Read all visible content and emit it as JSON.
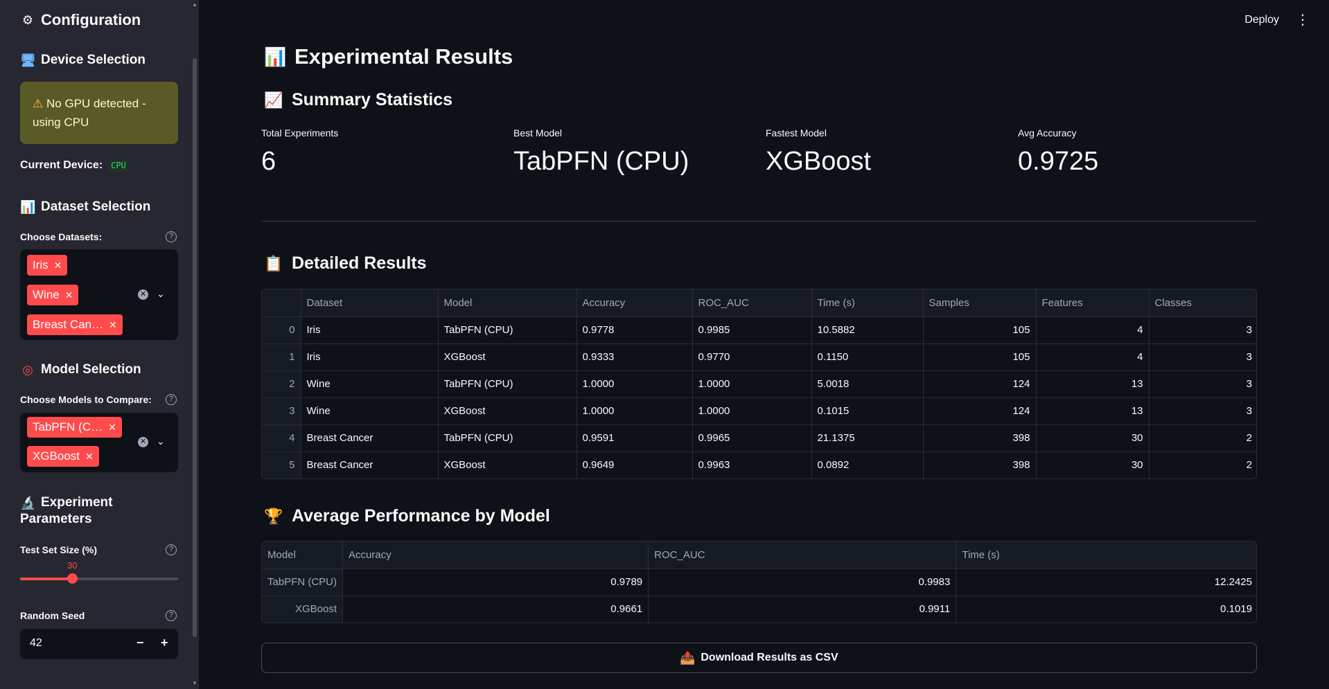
{
  "sidebar": {
    "title": "Configuration",
    "device_section": "Device Selection",
    "warning_line1": "No GPU detected -",
    "warning_line2": "using CPU",
    "current_device_label": "Current Device:",
    "current_device_value": "CPU",
    "dataset_section": "Dataset Selection",
    "datasets_label": "Choose Datasets:",
    "dataset_tags": [
      "Iris",
      "Wine",
      "Breast Can…"
    ],
    "model_section": "Model Selection",
    "models_label": "Choose Models to Compare:",
    "model_tags": [
      "TabPFN (C…",
      "XGBoost"
    ],
    "experiment_section_line1": "Experiment",
    "experiment_section_line2": "Parameters",
    "test_size_label": "Test Set Size (%)",
    "test_size_value": "30",
    "test_size_fraction": 0.33,
    "seed_label": "Random Seed",
    "seed_value": "42"
  },
  "topbar": {
    "deploy_label": "Deploy"
  },
  "main": {
    "title": "Experimental Results",
    "summary_title": "Summary Statistics",
    "metrics": [
      {
        "label": "Total Experiments",
        "value": "6"
      },
      {
        "label": "Best Model",
        "value": "TabPFN (CPU)"
      },
      {
        "label": "Fastest Model",
        "value": "XGBoost"
      },
      {
        "label": "Avg Accuracy",
        "value": "0.9725"
      }
    ],
    "detailed_title": "Detailed Results",
    "detailed_columns": [
      "",
      "Dataset",
      "Model",
      "Accuracy",
      "ROC_AUC",
      "Time (s)",
      "Samples",
      "Features",
      "Classes"
    ],
    "detailed_rows": [
      [
        "0",
        "Iris",
        "TabPFN (CPU)",
        "0.9778",
        "0.9985",
        "10.5882",
        "105",
        "4",
        "3"
      ],
      [
        "1",
        "Iris",
        "XGBoost",
        "0.9333",
        "0.9770",
        "0.1150",
        "105",
        "4",
        "3"
      ],
      [
        "2",
        "Wine",
        "TabPFN (CPU)",
        "1.0000",
        "1.0000",
        "5.0018",
        "124",
        "13",
        "3"
      ],
      [
        "3",
        "Wine",
        "XGBoost",
        "1.0000",
        "1.0000",
        "0.1015",
        "124",
        "13",
        "3"
      ],
      [
        "4",
        "Breast Cancer",
        "TabPFN (CPU)",
        "0.9591",
        "0.9965",
        "21.1375",
        "398",
        "30",
        "2"
      ],
      [
        "5",
        "Breast Cancer",
        "XGBoost",
        "0.9649",
        "0.9963",
        "0.0892",
        "398",
        "30",
        "2"
      ]
    ],
    "avg_title": "Average Performance by Model",
    "avg_columns": [
      "Model",
      "Accuracy",
      "ROC_AUC",
      "Time (s)"
    ],
    "avg_rows": [
      [
        "TabPFN (CPU)",
        "0.9789",
        "0.9983",
        "12.2425"
      ],
      [
        "XGBoost",
        "0.9661",
        "0.9911",
        "0.1019"
      ]
    ],
    "download_label": "Download Results as CSV"
  },
  "colors": {
    "accent": "#ff4b4b",
    "background": "#0e1117",
    "sidebar": "#262730",
    "warning_bg": "#5a5a26"
  },
  "icons": {
    "title": "gear-icon",
    "device": "desktop-icon",
    "dataset": "bar-chart-icon",
    "model": "target-icon",
    "experiment": "microscope-icon",
    "results": "bar-chart-icon",
    "summary": "chart-increasing-icon",
    "detailed": "clipboard-icon",
    "avg": "trophy-icon",
    "download": "outbox-icon"
  }
}
